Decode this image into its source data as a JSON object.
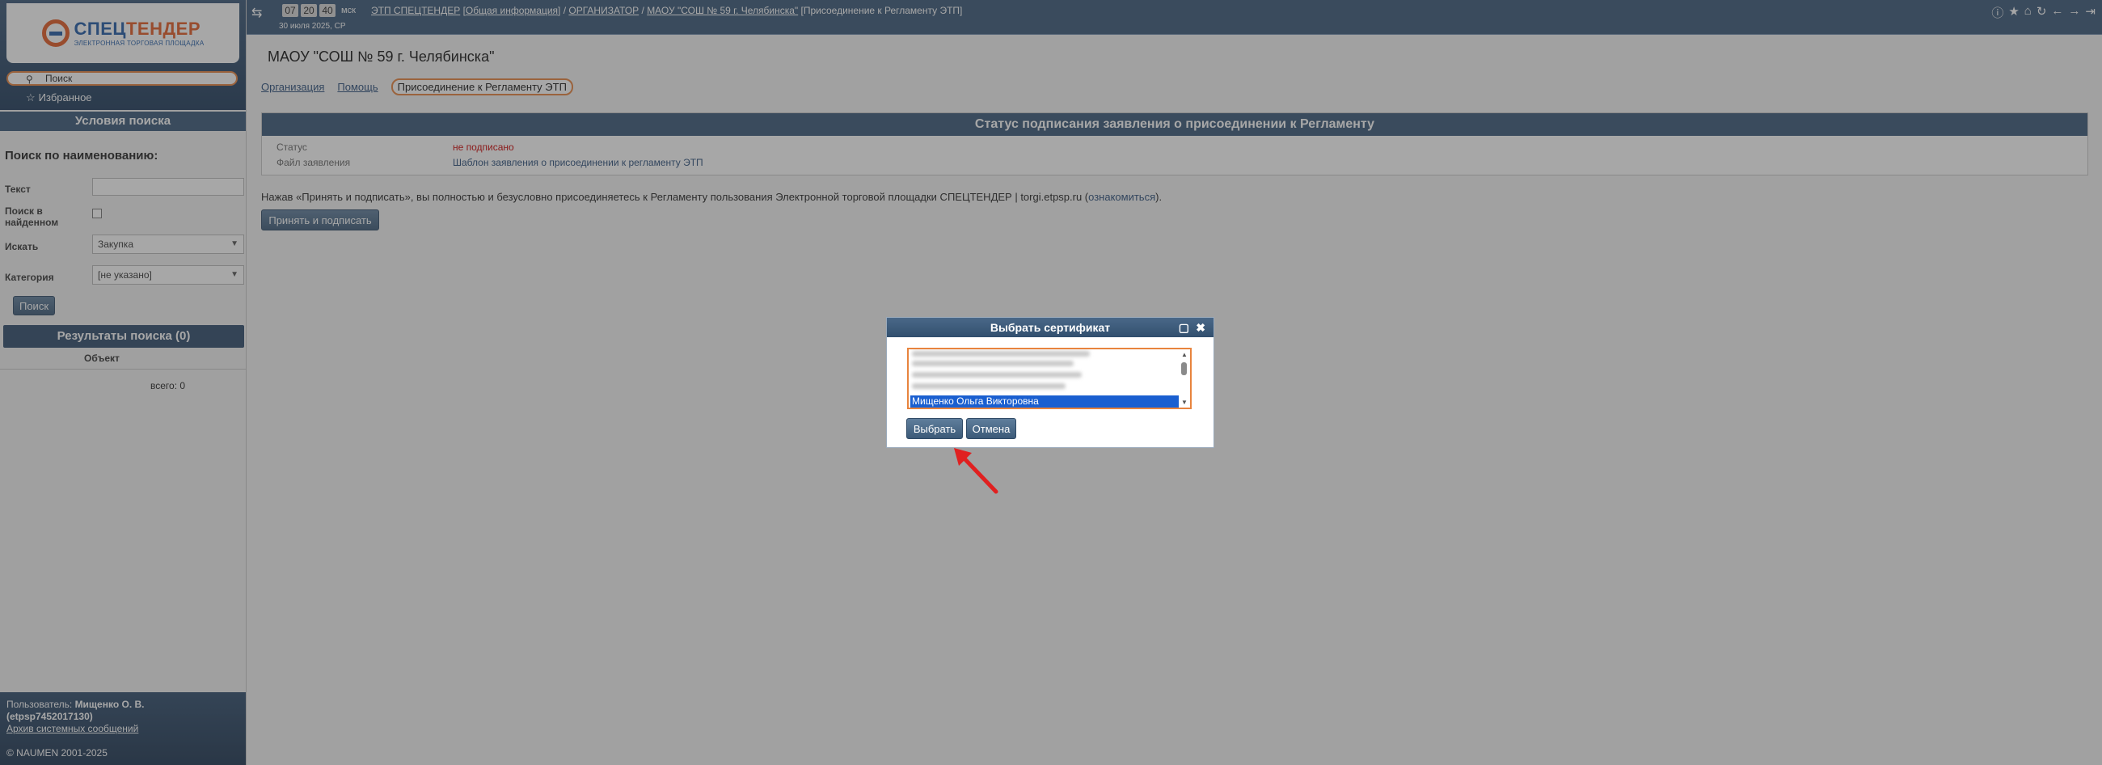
{
  "sidebar": {
    "logo_main_a": "СПЕЦ",
    "logo_main_b": "ТЕНДЕР",
    "logo_sub": "ЭЛЕКТРОННАЯ ТОРГОВАЯ ПЛОЩАДКА",
    "search_label": "Поиск",
    "favorites_label": "Избранное",
    "conditions_header": "Условия поиска",
    "name_search_header": "Поиск по наименованию:",
    "field_text_label": "Текст",
    "field_in_found_label_1": "Поиск в",
    "field_in_found_label_2": "найденном",
    "field_search_label": "Искать",
    "field_search_value": "Закупка",
    "field_category_label": "Категория",
    "field_category_value": "[не указано]",
    "search_button": "Поиск",
    "results_header": "Результаты поиска (0)",
    "column_object": "Объект",
    "total": "всего: 0",
    "user_prefix": "Пользователь:",
    "user_name": "Мищенко О. В.",
    "user_id": "(etpsp7452017130)",
    "archive_link": "Архив системных сообщений",
    "copyright": "© NAUMEN 2001-2025"
  },
  "topbar": {
    "clock_h": "07",
    "clock_m": "20",
    "clock_s": "40",
    "timezone": "мск",
    "date": "30 июля 2025, СР",
    "crumb_1": "ЭТП СПЕЦТЕНДЕР",
    "crumb_1b": "Общая информация",
    "crumb_2": "ОРГАНИЗАТОР",
    "crumb_3": "МАОУ \"СОШ № 59 г. Челябинска\"",
    "crumb_3b": "Присоединение к Регламенту ЭТП"
  },
  "main": {
    "page_title": "МАОУ \"СОШ № 59 г. Челябинска\"",
    "tabs": [
      {
        "label": "Организация"
      },
      {
        "label": "Помощь"
      },
      {
        "label": "Присоединение к Регламенту ЭТП"
      }
    ],
    "panel_header": "Статус подписания заявления о присоединении к Регламенту",
    "status_key": "Статус",
    "status_value": "не подписано",
    "file_key": "Файл заявления",
    "file_value": "Шаблон заявления о присоединении к регламенту ЭТП",
    "notice_text": "Нажав «Принять и подписать», вы полностью и безусловно присоединяетесь к Регламенту пользования Электронной торговой площадки СПЕЦТЕНДЕР | torgi.etpsp.ru (",
    "notice_link": "ознакомиться",
    "notice_tail": ").",
    "accept_button": "Принять и подписать"
  },
  "dialog": {
    "title": "Выбрать сертификат",
    "selected_cert": "Мищенко Ольга Викторовна",
    "select_button": "Выбрать",
    "cancel_button": "Отмена"
  },
  "colors": {
    "header_blue": "#3a5878",
    "focus_orange": "#e8843e",
    "selection_blue": "#1a5fd0",
    "status_red": "#cc0000",
    "annotation_arrow": "#e02020"
  }
}
